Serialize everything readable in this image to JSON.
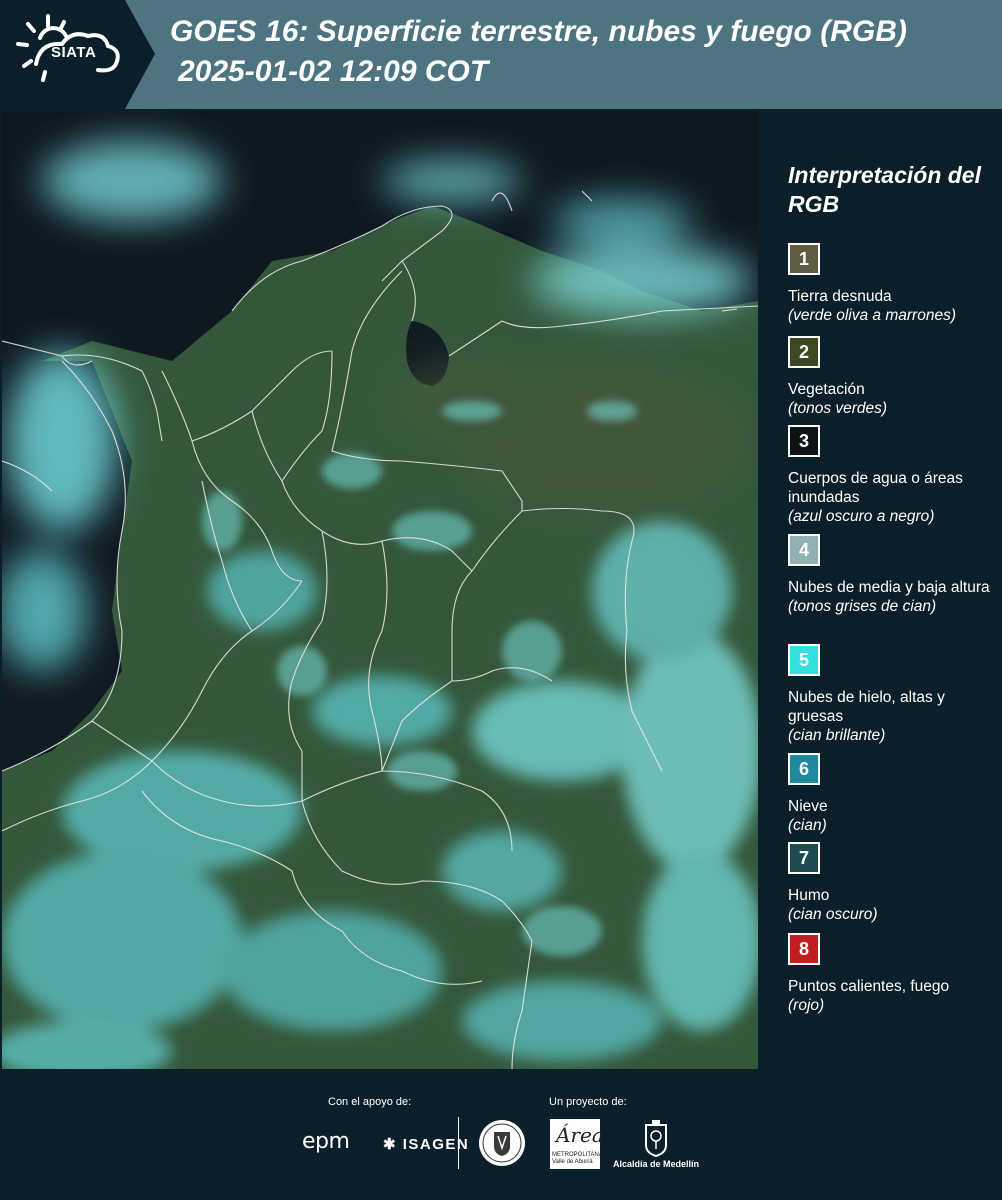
{
  "header": {
    "logo_text": "SIATA",
    "title": "GOES 16: Superficie terrestre, nubes y fuego (RGB)",
    "subtitle": "2025-01-02 12:09 COT"
  },
  "legend": {
    "title": "Interpretación del RGB",
    "items": [
      {
        "number": "1",
        "label": "Tierra desnuda",
        "note": "(verde oliva a marrones)",
        "color": "#5f5c45"
      },
      {
        "number": "2",
        "label": "Vegetación",
        "note": "(tonos verdes)",
        "color": "#3b4a22"
      },
      {
        "number": "3",
        "label": "Cuerpos de agua o áreas inundadas",
        "note": "(azul oscuro a negro)",
        "color": "#0d1418"
      },
      {
        "number": "4",
        "label": "Nubes de media y baja altura",
        "note": "(tonos grises de cian)",
        "color": "#8fb1b1"
      },
      {
        "number": "5",
        "label": "Nubes de hielo, altas y gruesas",
        "note": "(cian brillante)",
        "color": "#33dede"
      },
      {
        "number": "6",
        "label": "Nieve",
        "note": "(cian)",
        "color": "#1d8a9b"
      },
      {
        "number": "7",
        "label": "Humo",
        "note": "(cian oscuro)",
        "color": "#1c4c50"
      },
      {
        "number": "8",
        "label": "Puntos calientes, fuego",
        "note": "(rojo)",
        "color": "#c21f22"
      }
    ]
  },
  "footer": {
    "support_label": "Con el apoyo de:",
    "project_label": "Un proyecto de:",
    "sponsor_1": "epm",
    "sponsor_2": "ISAGEN",
    "area_logo_text": "Área",
    "area_logo_sub": "METROPOLITANA Valle de Aburrá",
    "alcaldia_text": "Alcaldía de Medellín"
  }
}
